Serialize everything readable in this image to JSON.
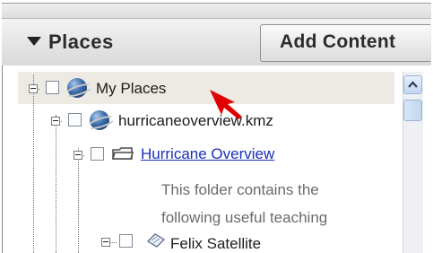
{
  "panel": {
    "title": "Places",
    "add_content_label": "Add Content"
  },
  "tree": {
    "root_label": "My Places",
    "kmz_label": "hurricaneoverview.kmz",
    "folder_link": "Hurricane Overview",
    "description_lines": [
      "This folder contains the",
      "following useful teaching"
    ],
    "satellite_label": "Felix Satellite"
  },
  "colors": {
    "link": "#1a2fb8",
    "pointer": "#e00000",
    "scroll_accent": "#9bb3d3"
  }
}
